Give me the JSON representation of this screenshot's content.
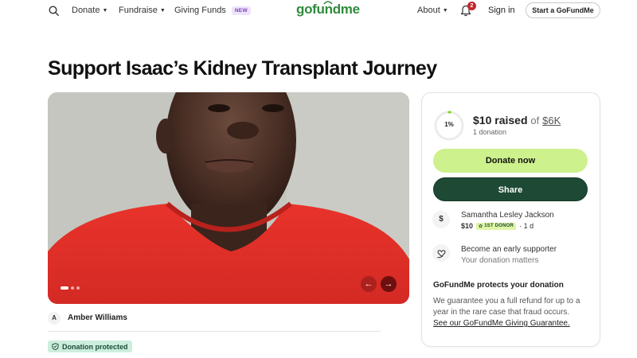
{
  "header": {
    "search_icon": "search-icon",
    "nav": [
      {
        "label": "Donate",
        "has_caret": true
      },
      {
        "label": "Fundraise",
        "has_caret": true
      },
      {
        "label": "Giving Funds",
        "badge": "NEW"
      }
    ],
    "logo": "gofundme",
    "about_label": "About",
    "notification_count": "2",
    "signin_label": "Sign in",
    "start_label": "Start a GoFundMe"
  },
  "page": {
    "title": "Support Isaac’s Kidney Transplant Journey"
  },
  "organizer": {
    "initial": "A",
    "name": "Amber Williams",
    "protected_label": "Donation protected"
  },
  "donation_card": {
    "progress_fraction": 0.01,
    "progress_label": "1%",
    "raised": "$10 raised",
    "of": "of",
    "goal": "$6K",
    "donation_count": "1 donation",
    "donate_label": "Donate now",
    "share_label": "Share",
    "donor": {
      "initial": "$",
      "name": "Samantha Lesley Jackson",
      "amount": "$10",
      "badge": "1ST DONOR",
      "time": "· 1 d"
    },
    "early_title": "Become an early supporter",
    "early_sub": "Your donation matters",
    "protect_title": "GoFundMe protects your donation",
    "protect_text": "We guarantee you a full refund for up to a year in the rare case that fraud occurs.",
    "protect_link": "See our GoFundMe Giving Guarantee."
  },
  "colors": {
    "brand_green": "#2e8b3b",
    "donate_button": "#cdf18c",
    "share_button": "#1e4a35",
    "notification_badge": "#c1272d",
    "protected_badge": "#cdeedd"
  }
}
